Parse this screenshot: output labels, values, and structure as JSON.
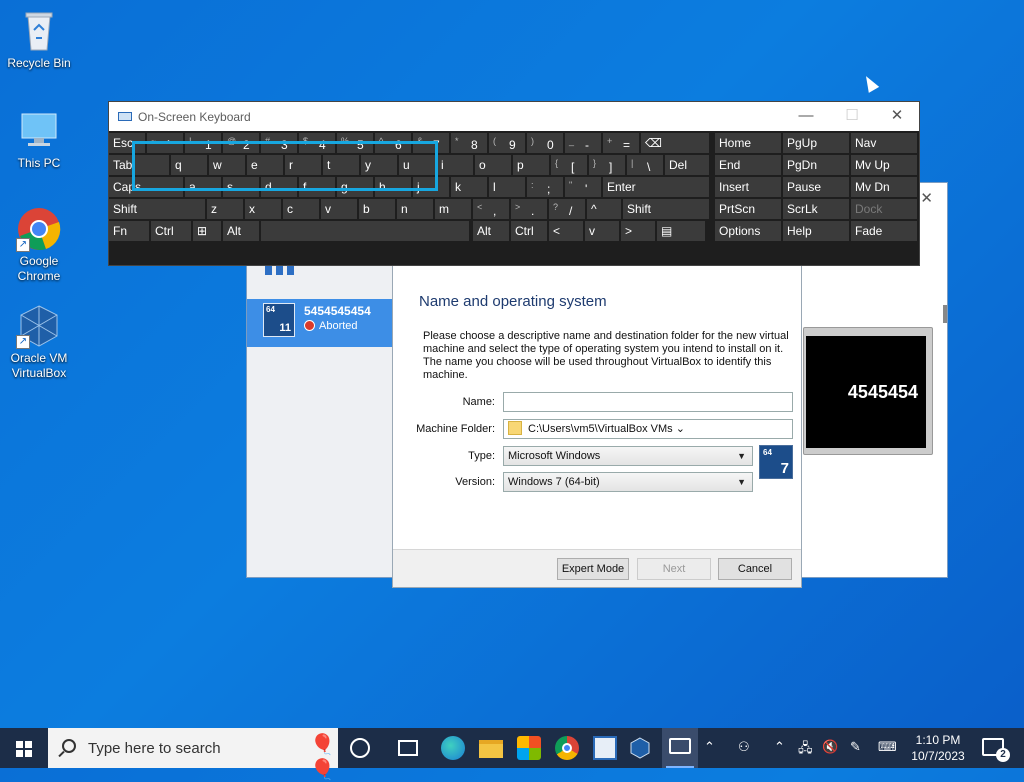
{
  "desktop": {
    "icons": [
      {
        "label": "Recycle Bin"
      },
      {
        "label": "This PC"
      },
      {
        "label": "Google Chrome"
      },
      {
        "label": "Oracle VM VirtualBox"
      }
    ]
  },
  "vbox_manager": {
    "vm_name": "5454545454",
    "vm_state": "Aborted",
    "vm_os_badge": "11",
    "preview_text": "4545454"
  },
  "dialog": {
    "title": "Name and operating system",
    "description": "Please choose a descriptive name and destination folder for the new virtual machine and select the type of operating system you intend to install on it. The name you choose will be used throughout VirtualBox to identify this machine.",
    "name_label": "Name:",
    "name_value": "",
    "folder_label": "Machine Folder:",
    "folder_value": "C:\\Users\\vm5\\VirtualBox VMs",
    "type_label": "Type:",
    "type_value": "Microsoft Windows",
    "version_label": "Version:",
    "version_value": "Windows 7 (64-bit)",
    "os_badge_bits": "64",
    "os_badge_num": "7",
    "buttons": {
      "expert": "Expert Mode",
      "next": "Next",
      "cancel": "Cancel"
    }
  },
  "osk": {
    "title": "On-Screen Keyboard",
    "rows": [
      [
        {
          "s": "",
          "m": "Esc"
        },
        {
          "s": "~",
          "m": "`"
        },
        {
          "s": "!",
          "m": "1"
        },
        {
          "s": "@",
          "m": "2"
        },
        {
          "s": "#",
          "m": "3"
        },
        {
          "s": "$",
          "m": "4"
        },
        {
          "s": "%",
          "m": "5"
        },
        {
          "s": "^",
          "m": "6"
        },
        {
          "s": "&",
          "m": "7"
        },
        {
          "s": "*",
          "m": "8"
        },
        {
          "s": "(",
          "m": "9"
        },
        {
          "s": ")",
          "m": "0"
        },
        {
          "s": "_",
          "m": "-"
        },
        {
          "s": "+",
          "m": "="
        },
        {
          "s": "",
          "m": "⌫"
        },
        {
          "s": "",
          "m": "Home"
        },
        {
          "s": "",
          "m": "PgUp"
        },
        {
          "s": "",
          "m": "Nav"
        }
      ],
      [
        {
          "s": "",
          "m": "Tab"
        },
        {
          "s": "",
          "m": "q"
        },
        {
          "s": "",
          "m": "w"
        },
        {
          "s": "",
          "m": "e"
        },
        {
          "s": "",
          "m": "r"
        },
        {
          "s": "",
          "m": "t"
        },
        {
          "s": "",
          "m": "y"
        },
        {
          "s": "",
          "m": "u"
        },
        {
          "s": "",
          "m": "i"
        },
        {
          "s": "",
          "m": "o"
        },
        {
          "s": "",
          "m": "p"
        },
        {
          "s": "{",
          "m": "["
        },
        {
          "s": "}",
          "m": "]"
        },
        {
          "s": "|",
          "m": "\\"
        },
        {
          "s": "",
          "m": "Del"
        },
        {
          "s": "",
          "m": "End"
        },
        {
          "s": "",
          "m": "PgDn"
        },
        {
          "s": "",
          "m": "Mv Up"
        }
      ],
      [
        {
          "s": "",
          "m": "Caps"
        },
        {
          "s": "",
          "m": "a"
        },
        {
          "s": "",
          "m": "s"
        },
        {
          "s": "",
          "m": "d"
        },
        {
          "s": "",
          "m": "f"
        },
        {
          "s": "",
          "m": "g"
        },
        {
          "s": "",
          "m": "h"
        },
        {
          "s": "",
          "m": "j"
        },
        {
          "s": "",
          "m": "k"
        },
        {
          "s": "",
          "m": "l"
        },
        {
          "s": ":",
          "m": ";"
        },
        {
          "s": "\"",
          "m": "'"
        },
        {
          "s": "",
          "m": "Enter"
        },
        {
          "s": "",
          "m": "Insert"
        },
        {
          "s": "",
          "m": "Pause"
        },
        {
          "s": "",
          "m": "Mv Dn"
        }
      ],
      [
        {
          "s": "",
          "m": "Shift"
        },
        {
          "s": "",
          "m": "z"
        },
        {
          "s": "",
          "m": "x"
        },
        {
          "s": "",
          "m": "c"
        },
        {
          "s": "",
          "m": "v"
        },
        {
          "s": "",
          "m": "b"
        },
        {
          "s": "",
          "m": "n"
        },
        {
          "s": "",
          "m": "m"
        },
        {
          "s": "<",
          "m": ","
        },
        {
          "s": ">",
          "m": "."
        },
        {
          "s": "?",
          "m": "/"
        },
        {
          "s": "",
          "m": "^"
        },
        {
          "s": "",
          "m": "Shift"
        },
        {
          "s": "",
          "m": "PrtScn"
        },
        {
          "s": "",
          "m": "ScrLk"
        },
        {
          "s": "",
          "m": "Dock"
        }
      ],
      [
        {
          "s": "",
          "m": "Fn"
        },
        {
          "s": "",
          "m": "Ctrl"
        },
        {
          "s": "",
          "m": "⊞"
        },
        {
          "s": "",
          "m": "Alt"
        },
        {
          "s": "",
          "m": ""
        },
        {
          "s": "",
          "m": "Alt"
        },
        {
          "s": "",
          "m": "Ctrl"
        },
        {
          "s": "",
          "m": "<"
        },
        {
          "s": "",
          "m": "v"
        },
        {
          "s": "",
          "m": ">"
        },
        {
          "s": "",
          "m": "▤"
        },
        {
          "s": "",
          "m": "Options"
        },
        {
          "s": "",
          "m": "Help"
        },
        {
          "s": "",
          "m": "Fade"
        }
      ]
    ]
  },
  "taskbar": {
    "search_placeholder": "Type here to search",
    "time": "1:10 PM",
    "date": "10/7/2023",
    "notification_count": "2"
  },
  "colors": {
    "desktop": "#0c7ddf",
    "taskbar": "#1c2d48",
    "osk_key": "#3b3b3b",
    "highlight": "#17a7e0",
    "vm_selected": "#3d8ee6"
  }
}
